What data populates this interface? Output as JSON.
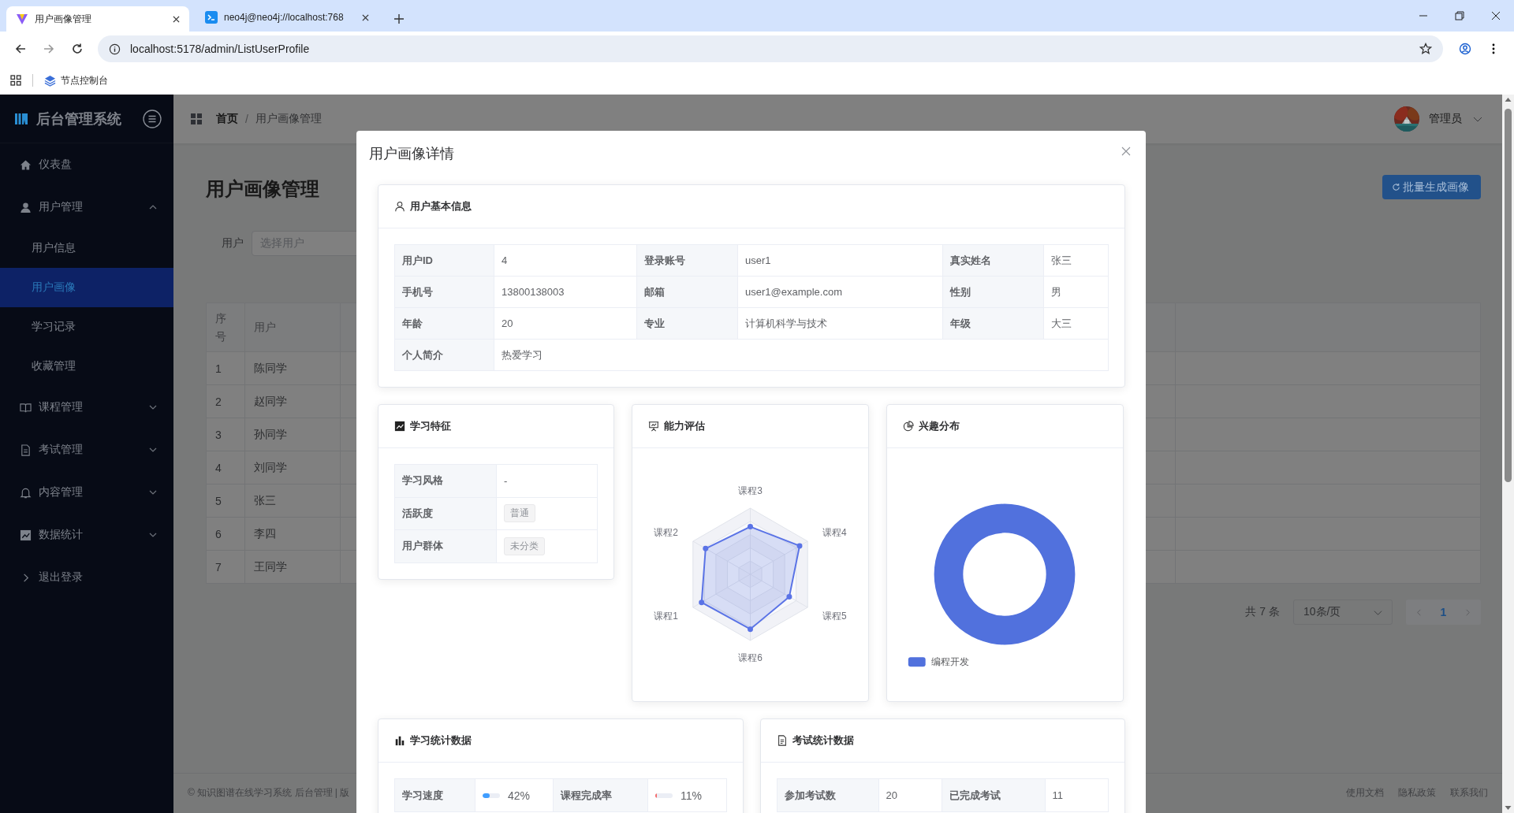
{
  "browser": {
    "tabs": [
      {
        "title": "用户画像管理",
        "selected": true
      },
      {
        "title": "neo4j@neo4j://localhost:768",
        "selected": false
      }
    ],
    "url": "localhost:5178/admin/ListUserProfile",
    "bookmarks": [
      "节点控制台"
    ]
  },
  "sidebar": {
    "title": "后台管理系统",
    "items": [
      {
        "label": "仪表盘",
        "selected": false
      },
      {
        "label": "用户管理",
        "selected": false,
        "expanded": true,
        "children": [
          {
            "label": "用户信息",
            "selected": false
          },
          {
            "label": "用户画像",
            "selected": true
          },
          {
            "label": "学习记录",
            "selected": false
          },
          {
            "label": "收藏管理",
            "selected": false
          }
        ]
      },
      {
        "label": "课程管理",
        "selected": false,
        "expanded": false
      },
      {
        "label": "考试管理",
        "selected": false,
        "expanded": false
      },
      {
        "label": "内容管理",
        "selected": false,
        "expanded": false
      },
      {
        "label": "数据统计",
        "selected": false,
        "expanded": false
      },
      {
        "label": "退出登录",
        "selected": false
      }
    ]
  },
  "header": {
    "breadcrumb": [
      "首页",
      "用户画像管理"
    ],
    "separator": "/",
    "user": "管理员"
  },
  "page": {
    "title": "用户画像管理",
    "batch_button": "批量生成画像",
    "filter": {
      "label": "用户",
      "placeholder": "选择用户"
    },
    "table": {
      "columns": [
        "序号",
        "用户"
      ],
      "rows": [
        [
          "1",
          "陈同学"
        ],
        [
          "2",
          "赵同学"
        ],
        [
          "3",
          "孙同学"
        ],
        [
          "4",
          "刘同学"
        ],
        [
          "5",
          "张三"
        ],
        [
          "6",
          "李四"
        ],
        [
          "7",
          "王同学"
        ]
      ]
    },
    "pagination": {
      "total": "共 7 条",
      "page_size": "10条/页",
      "pages": [
        {
          "label": "1",
          "selected": true
        }
      ]
    }
  },
  "footer": {
    "copyright": "© 知识图谱在线学习系统 后台管理 | 版",
    "links": [
      "使用文档",
      "隐私政策",
      "联系我们"
    ]
  },
  "dialog": {
    "title": "用户画像详情",
    "basic_info": {
      "title": "用户基本信息",
      "fields": [
        {
          "label": "用户ID",
          "value": "4"
        },
        {
          "label": "登录账号",
          "value": "user1"
        },
        {
          "label": "真实姓名",
          "value": "张三"
        },
        {
          "label": "手机号",
          "value": "13800138003"
        },
        {
          "label": "邮箱",
          "value": "user1@example.com"
        },
        {
          "label": "性别",
          "value": "男"
        },
        {
          "label": "年龄",
          "value": "20"
        },
        {
          "label": "专业",
          "value": "计算机科学与技术"
        },
        {
          "label": "年级",
          "value": "大三"
        }
      ],
      "bio": {
        "label": "个人简介",
        "value": "热爱学习"
      }
    },
    "learning_features": {
      "title": "学习特征",
      "rows": [
        {
          "label": "学习风格",
          "value": "-",
          "kind": "text"
        },
        {
          "label": "活跃度",
          "value": "普通",
          "kind": "tag"
        },
        {
          "label": "用户群体",
          "value": "未分类",
          "kind": "tag"
        }
      ]
    },
    "ability": {
      "title": "能力评估",
      "axes": [
        "课程3",
        "课程4",
        "课程5",
        "课程6",
        "课程1",
        "课程2"
      ]
    },
    "interest": {
      "title": "兴趣分布",
      "legend": [
        {
          "label": "编程开发",
          "color": "#5171dd"
        }
      ]
    },
    "learning_stats": {
      "title": "学习统计数据",
      "rows": [
        [
          {
            "label": "学习速度",
            "level": 0.42,
            "reading": "42%",
            "color": "#409eff"
          },
          {
            "label": "课程完成率",
            "level": 0.11,
            "reading": "11%",
            "color": "#f56c6c"
          }
        ]
      ]
    },
    "exam_stats": {
      "title": "考试统计数据",
      "rows": [
        [
          {
            "label": "参加考试数",
            "value": "20"
          },
          {
            "label": "已完成考试",
            "value": "11"
          }
        ]
      ]
    }
  }
}
